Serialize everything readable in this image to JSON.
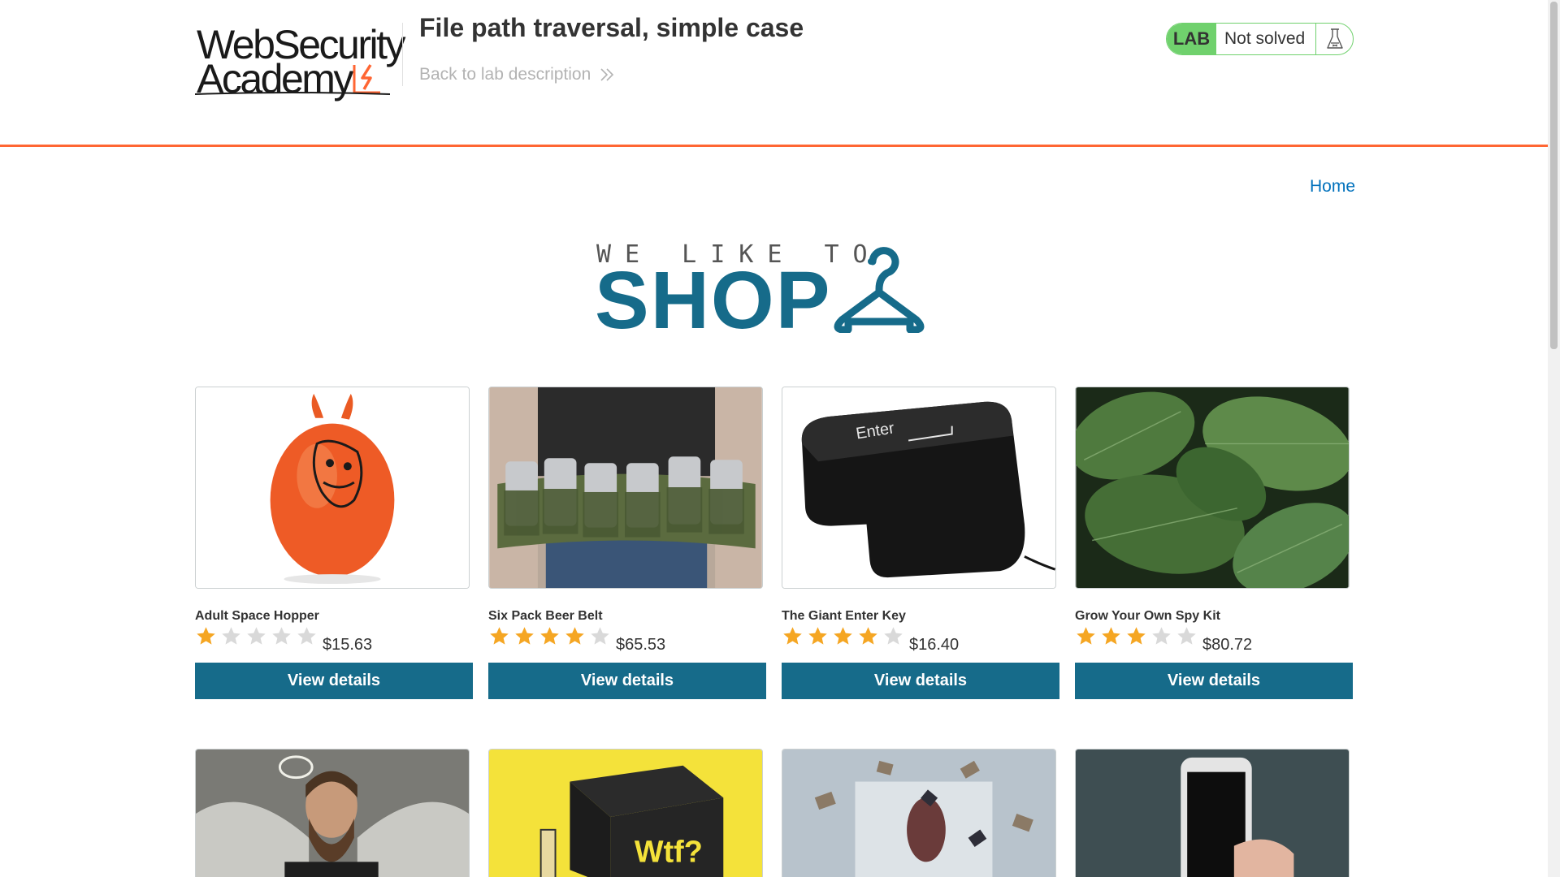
{
  "header": {
    "logo_line1": "WebSecurity",
    "logo_line2": "Academy",
    "lab_title": "File path traversal, simple case",
    "back_link": "Back to lab description",
    "lab_badge": "LAB",
    "lab_status": "Not solved",
    "accent_color": "#ff6633",
    "status_color": "#70d16d"
  },
  "nav": {
    "home": "Home"
  },
  "banner": {
    "small": "WE LIKE TO",
    "big": "SHOP"
  },
  "products": [
    {
      "name": "Adult Space Hopper",
      "price": "$15.63",
      "rating": 1,
      "button": "View details"
    },
    {
      "name": "Six Pack Beer Belt",
      "price": "$65.53",
      "rating": 4,
      "button": "View details"
    },
    {
      "name": "The Giant Enter Key",
      "price": "$16.40",
      "rating": 4,
      "button": "View details"
    },
    {
      "name": "Grow Your Own Spy Kit",
      "price": "$80.72",
      "rating": 3,
      "button": "View details"
    }
  ],
  "image_text": {
    "enter_key": "Enter",
    "wtf_box": "Wtf?"
  },
  "colors": {
    "button": "#166b8a",
    "link": "#0071bc",
    "star_on": "#f5a623",
    "star_off": "#d9d9d9"
  }
}
